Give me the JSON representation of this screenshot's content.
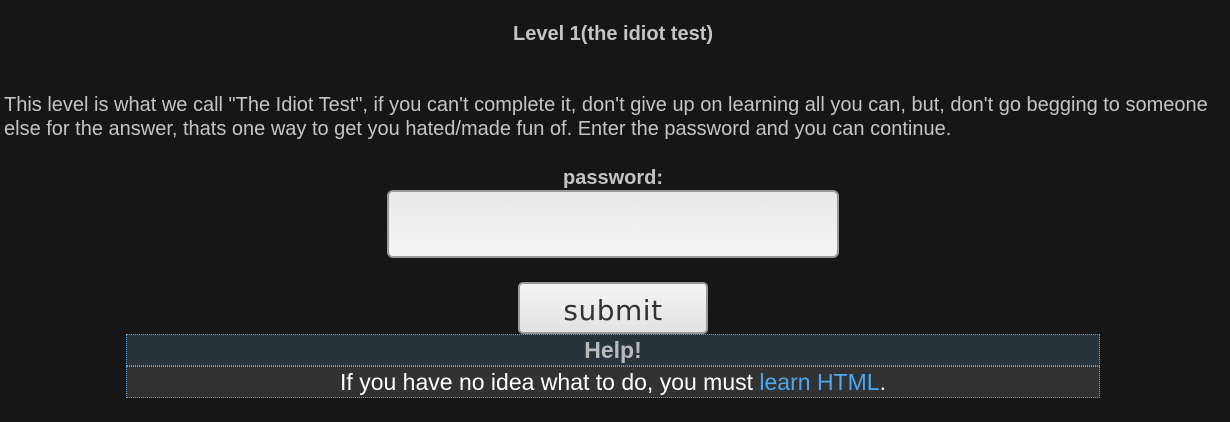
{
  "level": {
    "title": "Level 1(the idiot test)",
    "intro": "This level is what we call \"The Idiot Test\", if you can't complete it, don't give up on learning all you can, but, don't go begging to someone else for the answer, thats one way to get you hated/made fun of. Enter the password and you can continue."
  },
  "form": {
    "password_label": "password:",
    "password_value": "",
    "submit_label": "submit"
  },
  "help": {
    "title": "Help!",
    "text_before": "If you have no idea what to do, you must ",
    "link_label": "learn HTML",
    "text_after": "."
  },
  "colors": {
    "background": "#161616",
    "text": "#c4c4c4",
    "link": "#4aa8f0",
    "help_border": "#4aa3e6"
  }
}
